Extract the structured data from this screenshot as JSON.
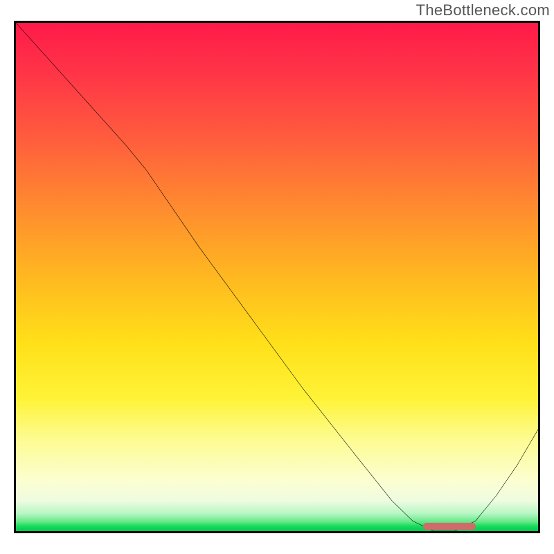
{
  "watermark_text": "TheBottleneck.com",
  "chart_data": {
    "type": "line",
    "title": "",
    "xlabel": "",
    "ylabel": "",
    "xlim": [
      0,
      100
    ],
    "ylim": [
      0,
      100
    ],
    "grid": false,
    "legend": false,
    "series": [
      {
        "name": "bottleneck-curve",
        "x": [
          0,
          7,
          14,
          21,
          25,
          35,
          45,
          55,
          65,
          72,
          76,
          80,
          84,
          88,
          92,
          96,
          100
        ],
        "values": [
          100,
          92,
          84,
          76,
          71,
          56,
          42,
          28,
          15,
          6,
          2,
          0,
          0,
          2,
          7,
          13,
          20
        ]
      }
    ],
    "background_gradient": {
      "top_color": "#ff1a49",
      "mid_color": "#ffe019",
      "bottom_edge_color": "#00c94a"
    },
    "optimal_marker": {
      "x_start": 78,
      "x_end": 88,
      "color": "#d16a6a"
    }
  }
}
